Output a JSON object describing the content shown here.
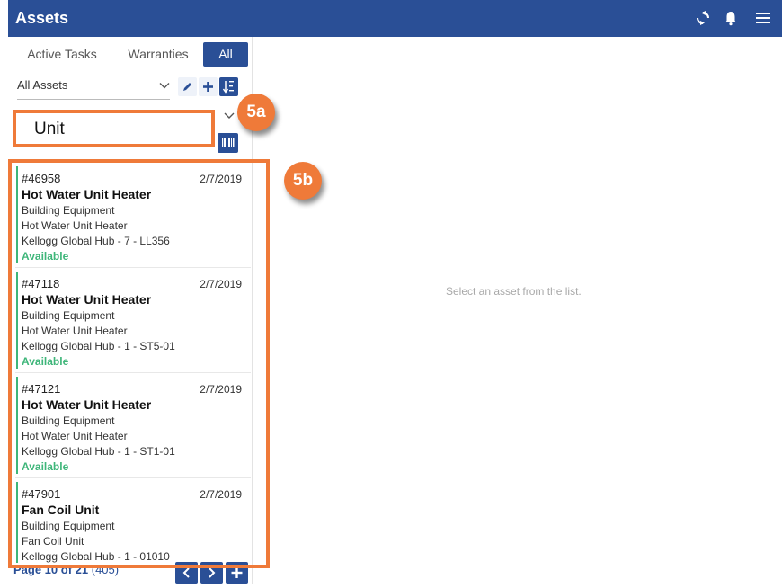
{
  "header": {
    "title": "Assets",
    "icons": [
      "sync-icon",
      "bell-icon",
      "menu-icon"
    ]
  },
  "tabs": [
    {
      "label": "Active Tasks",
      "active": false
    },
    {
      "label": "Warranties",
      "active": false
    },
    {
      "label": "All",
      "active": true
    }
  ],
  "filter": {
    "value": "All Assets",
    "actions": [
      "pencil-icon",
      "plus-icon",
      "sort-alpha-icon"
    ]
  },
  "search": {
    "value": "Unit"
  },
  "assets": [
    {
      "number": "#46958",
      "date": "2/7/2019",
      "name": "Hot Water Unit Heater",
      "category": "Building Equipment",
      "type": "Hot Water Unit Heater",
      "location": "Kellogg Global Hub - 7 - LL356",
      "status": "Available"
    },
    {
      "number": "#47118",
      "date": "2/7/2019",
      "name": "Hot Water Unit Heater",
      "category": "Building Equipment",
      "type": "Hot Water Unit Heater",
      "location": "Kellogg Global Hub - 1 - ST5-01",
      "status": "Available"
    },
    {
      "number": "#47121",
      "date": "2/7/2019",
      "name": "Hot Water Unit Heater",
      "category": "Building Equipment",
      "type": "Hot Water Unit Heater",
      "location": "Kellogg Global Hub - 1 - ST1-01",
      "status": "Available"
    },
    {
      "number": "#47901",
      "date": "2/7/2019",
      "name": "Fan Coil Unit",
      "category": "Building Equipment",
      "type": "Fan Coil Unit",
      "location": "Kellogg Global Hub - 1 - 01010",
      "status": ""
    }
  ],
  "pagination": {
    "label": "Page 10 of 21",
    "count": "(405)"
  },
  "detail": {
    "empty_message": "Select an asset from the list."
  },
  "annotations": {
    "badge_a": "5a",
    "badge_b": "5b"
  },
  "colors": {
    "brand": "#2a4f96",
    "status_available": "#3fb67a",
    "annotation": "#ef7a39"
  }
}
